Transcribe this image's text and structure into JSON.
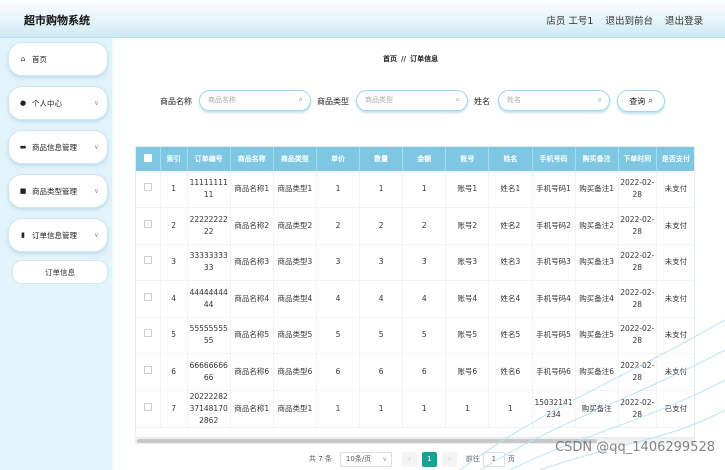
{
  "app": {
    "title": "超市购物系统"
  },
  "header": {
    "user": "店员 工号1",
    "front": "退出到前台",
    "logout": "退出登录"
  },
  "sidebar": {
    "items": [
      {
        "label": "首页",
        "icon": "home-icon",
        "glyph": "⌂"
      },
      {
        "label": "个人中心",
        "icon": "user-icon",
        "glyph": "●"
      },
      {
        "label": "商品信息管理",
        "icon": "shop-icon",
        "glyph": "▬"
      },
      {
        "label": "商品类型管理",
        "icon": "monitor-icon",
        "glyph": "■"
      },
      {
        "label": "订单信息管理",
        "icon": "clipboard-icon",
        "glyph": "▮"
      }
    ],
    "sub": "订单信息"
  },
  "breadcrumb": {
    "home": "首页",
    "sep": "//",
    "current": "订单信息"
  },
  "search": {
    "name_label": "商品名称",
    "name_placeholder": "商品名称",
    "type_label": "商品类型",
    "type_placeholder": "商品类型",
    "user_label": "姓名",
    "user_placeholder": "姓名",
    "button": "查询"
  },
  "table": {
    "columns": [
      "索引",
      "订单编号",
      "商品名称",
      "商品类型",
      "单价",
      "数量",
      "金额",
      "账号",
      "姓名",
      "手机号码",
      "购买备注",
      "下单时间",
      "是否支付"
    ],
    "rows": [
      [
        "1",
        "1111111111",
        "商品名称1",
        "商品类型1",
        "1",
        "1",
        "1",
        "账号1",
        "姓名1",
        "手机号码1",
        "购买备注1",
        "2022-02-28",
        "未支付"
      ],
      [
        "2",
        "2222222222",
        "商品名称2",
        "商品类型2",
        "2",
        "2",
        "2",
        "账号2",
        "姓名2",
        "手机号码2",
        "购买备注2",
        "2022-02-28",
        "未支付"
      ],
      [
        "3",
        "3333333333",
        "商品名称3",
        "商品类型3",
        "3",
        "3",
        "3",
        "账号3",
        "姓名3",
        "手机号码3",
        "购买备注3",
        "2022-02-28",
        "未支付"
      ],
      [
        "4",
        "4444444444",
        "商品名称4",
        "商品类型4",
        "4",
        "4",
        "4",
        "账号4",
        "姓名4",
        "手机号码4",
        "购买备注4",
        "2022-02-28",
        "未支付"
      ],
      [
        "5",
        "5555555555",
        "商品名称5",
        "商品类型5",
        "5",
        "5",
        "5",
        "账号5",
        "姓名5",
        "手机号码5",
        "购买备注5",
        "2022-02-28",
        "未支付"
      ],
      [
        "6",
        "6666666666",
        "商品名称6",
        "商品类型6",
        "6",
        "6",
        "6",
        "账号6",
        "姓名6",
        "手机号码6",
        "购买备注6",
        "2022-02-28",
        "未支付"
      ],
      [
        "7",
        "20222282371481702862",
        "商品名称1",
        "商品类型1",
        "1",
        "1",
        "1",
        "1",
        "1",
        "15032141234",
        "购买备注",
        "2022-02-28",
        "已支付"
      ]
    ]
  },
  "pager": {
    "total": "共 7 条",
    "size": "10条/页",
    "prev": "‹",
    "current": "1",
    "next": "›",
    "goto": "前往",
    "jump": "1",
    "page_unit": "页"
  },
  "watermark": "CSDN @qq_1406299528"
}
